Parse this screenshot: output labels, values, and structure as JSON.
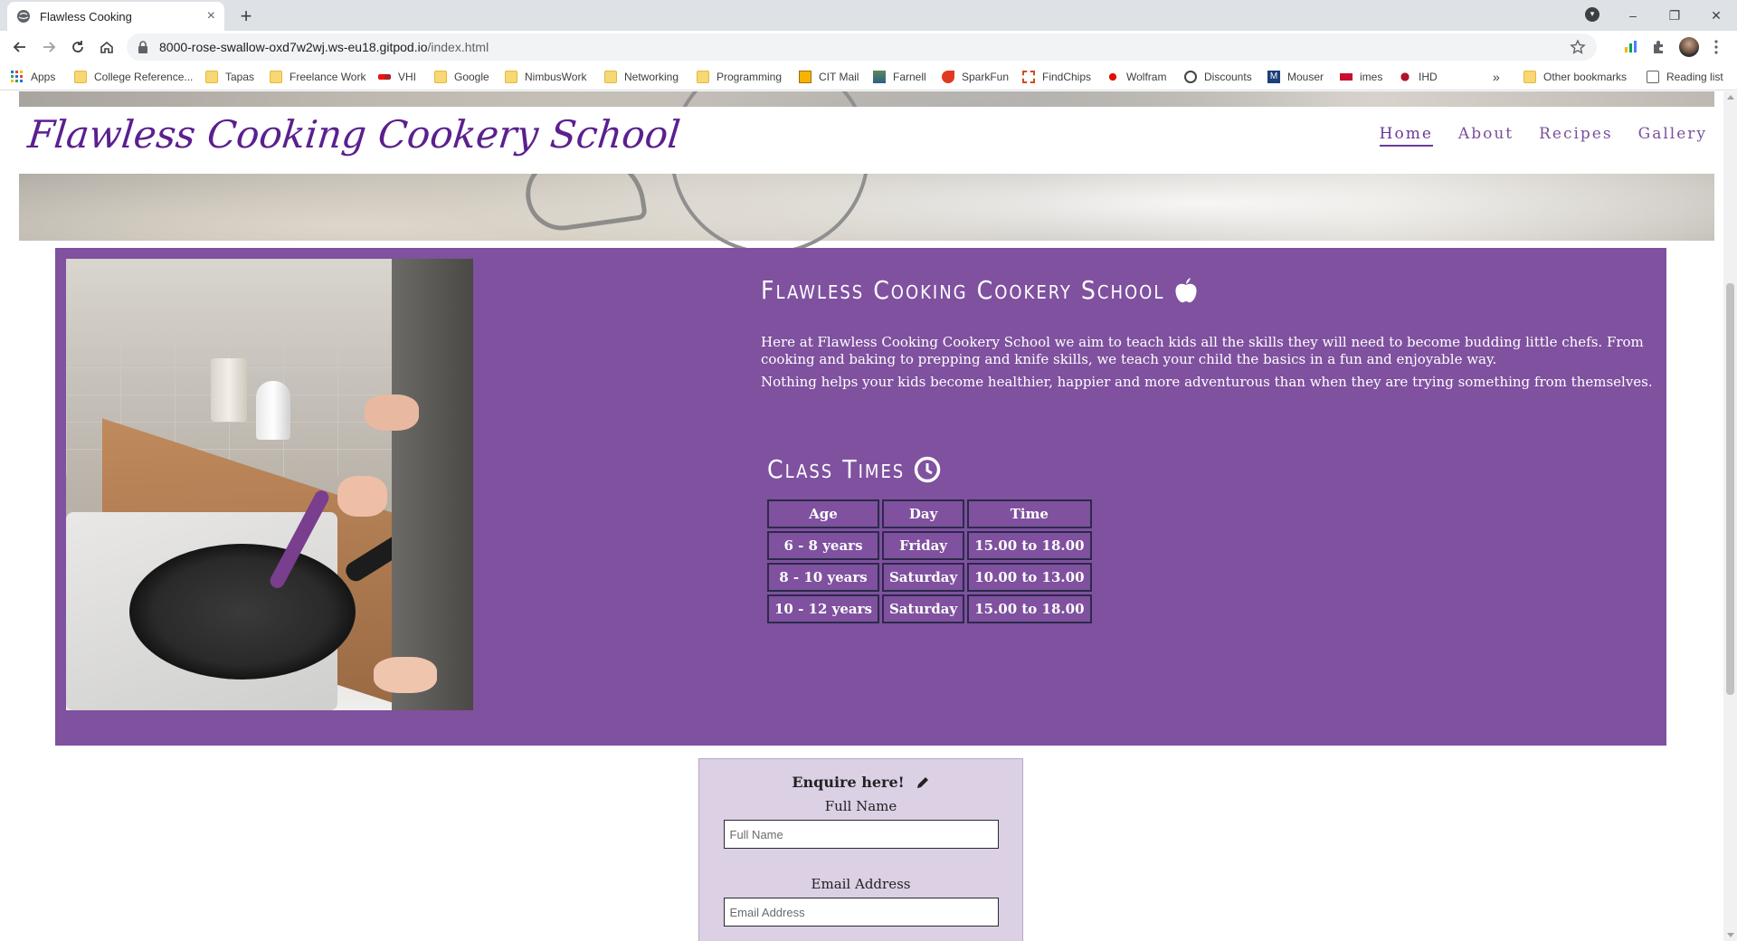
{
  "browser": {
    "tab_title": "Flawless Cooking",
    "tab_close": "×",
    "new_tab": "+",
    "url_host": "8000-rose-swallow-oxd7w2wj.ws-eu18.gitpod.io",
    "url_path": "/index.html",
    "window_controls": {
      "minimize": "–",
      "restore": "❐",
      "close": "✕"
    }
  },
  "bookmarks": {
    "apps": "Apps",
    "items": [
      "College Reference...",
      "Tapas",
      "Freelance Work",
      "VHI",
      "Google",
      "NimbusWork",
      "Networking",
      "Programming",
      "CIT Mail",
      "Farnell",
      "SparkFun",
      "FindChips",
      "Wolfram",
      "Discounts",
      "Mouser",
      "imes",
      "IHD"
    ],
    "overflow": "»",
    "other": "Other bookmarks",
    "reading_list": "Reading list"
  },
  "site": {
    "brand": "Flawless Cooking Cookery School",
    "nav": [
      "Home",
      "About",
      "Recipes",
      "Gallery"
    ],
    "active_nav": "Home"
  },
  "intro": {
    "heading": "Flawless Cooking Cookery School",
    "paragraph1": "Here at Flawless Cooking Cookery School we aim to teach kids all the skills they will need to become budding little chefs. From cooking and baking to prepping and knife skills, we teach your child the basics in a fun and enjoyable way.",
    "paragraph2": "Nothing helps your kids become healthier, happier and more adventurous than when they are trying something from themselves."
  },
  "class_times": {
    "heading": "Class Times",
    "headers": [
      "Age",
      "Day",
      "Time"
    ],
    "rows": [
      [
        "6 - 8 years",
        "Friday",
        "15.00 to 18.00"
      ],
      [
        "8 - 10 years",
        "Saturday",
        "10.00 to 13.00"
      ],
      [
        "10 - 12 years",
        "Saturday",
        "15.00 to 18.00"
      ]
    ]
  },
  "enquire": {
    "heading": "Enquire here!",
    "name_label": "Full Name",
    "name_placeholder": "Full Name",
    "email_label": "Email Address",
    "email_placeholder": "Email Address"
  },
  "colors": {
    "content_bg": "#7f519f",
    "brand": "#5b1f8f",
    "form_bg": "#dcd0e5"
  }
}
